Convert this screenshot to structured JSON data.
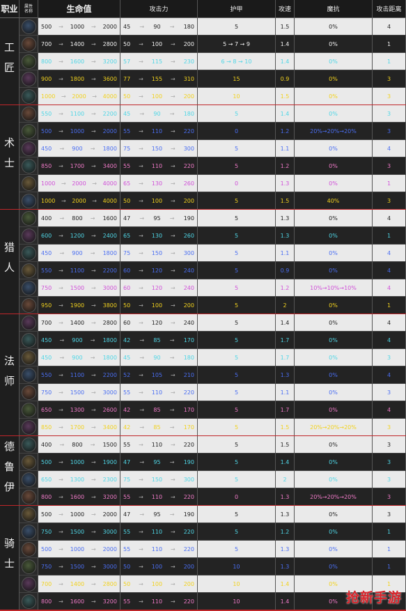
{
  "header": {
    "class": "职业",
    "avatar_top": "属性",
    "avatar_bottom": "名称",
    "hp": "生命值",
    "atk": "攻击力",
    "armor": "护甲",
    "speed": "攻速",
    "mr": "魔抗",
    "range": "攻击距离"
  },
  "colors": {
    "white": "#f2f2f2",
    "cyan": "#4fd6e6",
    "yellow": "#f2d21e",
    "pink": "#f07ac8",
    "blue": "#4a6ef2",
    "purple": "#d050d8",
    "orange": "#f0a020",
    "row_light": "#eaeaea",
    "row_dark": "#232323",
    "separator": "#c0262a"
  },
  "classes": [
    {
      "name": "工匠",
      "rows": [
        {
          "color": "white",
          "hp": [
            "500",
            "1000",
            "2000"
          ],
          "atk": [
            "45",
            "90",
            "180"
          ],
          "armor": "5",
          "speed": "1.5",
          "mr": "0%",
          "range": "4"
        },
        {
          "color": "white",
          "hp": [
            "700",
            "1400",
            "2800"
          ],
          "atk": [
            "50",
            "100",
            "200"
          ],
          "armor": "5 → 7 → 9",
          "speed": "1.4",
          "mr": "0%",
          "range": "1"
        },
        {
          "color": "cyan",
          "hp": [
            "800",
            "1600",
            "3200"
          ],
          "atk": [
            "57",
            "115",
            "230"
          ],
          "armor": "6 → 8 → 10",
          "speed": "1.4",
          "mr": "0%",
          "range": "1"
        },
        {
          "color": "yellow",
          "hp": [
            "900",
            "1800",
            "3600"
          ],
          "atk": [
            "77",
            "155",
            "310"
          ],
          "armor": "15",
          "speed": "0.9",
          "mr": "0%",
          "range": "3"
        },
        {
          "color": "yellow",
          "hp": [
            "1000",
            "2000",
            "4000"
          ],
          "atk": [
            "50",
            "100",
            "200"
          ],
          "armor": "10",
          "speed": "1.5",
          "mr": "0%",
          "range": "3"
        }
      ]
    },
    {
      "name": "术士",
      "rows": [
        {
          "color": "cyan",
          "hp": [
            "550",
            "1100",
            "2200"
          ],
          "atk": [
            "45",
            "90",
            "180"
          ],
          "armor": "5",
          "speed": "1.4",
          "mr": "0%",
          "range": "3"
        },
        {
          "color": "blue",
          "hp": [
            "500",
            "1000",
            "2000"
          ],
          "atk": [
            "55",
            "110",
            "220"
          ],
          "armor": "0",
          "speed": "1.2",
          "mr": "20%→20%→20%",
          "range": "3"
        },
        {
          "color": "blue",
          "hp": [
            "450",
            "900",
            "1800"
          ],
          "atk": [
            "75",
            "150",
            "300"
          ],
          "armor": "5",
          "speed": "1.1",
          "mr": "0%",
          "range": "4"
        },
        {
          "color": "pink",
          "hp": [
            "850",
            "1700",
            "3400"
          ],
          "atk": [
            "55",
            "110",
            "220"
          ],
          "armor": "5",
          "speed": "1.2",
          "mr": "0%",
          "range": "3"
        },
        {
          "color": "purple",
          "hp": [
            "1000",
            "2000",
            "4000"
          ],
          "atk": [
            "65",
            "130",
            "260"
          ],
          "armor": "0",
          "speed": "1.3",
          "mr": "0%",
          "range": "1"
        },
        {
          "color": "yellow",
          "hp": [
            "1000",
            "2000",
            "4000"
          ],
          "atk": [
            "50",
            "100",
            "200"
          ],
          "armor": "5",
          "speed": "1.5",
          "mr": "40%",
          "range": "3"
        }
      ]
    },
    {
      "name": "猎人",
      "rows": [
        {
          "color": "white",
          "hp": [
            "400",
            "800",
            "1600"
          ],
          "atk": [
            "47",
            "95",
            "190"
          ],
          "armor": "5",
          "speed": "1.3",
          "mr": "0%",
          "range": "4"
        },
        {
          "color": "cyan",
          "hp": [
            "600",
            "1200",
            "2400"
          ],
          "atk": [
            "65",
            "130",
            "260"
          ],
          "armor": "5",
          "speed": "1.3",
          "mr": "0%",
          "range": "1"
        },
        {
          "color": "blue",
          "hp": [
            "450",
            "900",
            "1800"
          ],
          "atk": [
            "75",
            "150",
            "300"
          ],
          "armor": "5",
          "speed": "1.1",
          "mr": "0%",
          "range": "4"
        },
        {
          "color": "blue",
          "hp": [
            "550",
            "1100",
            "2200"
          ],
          "atk": [
            "60",
            "120",
            "240"
          ],
          "armor": "5",
          "speed": "0.9",
          "mr": "0%",
          "range": "4"
        },
        {
          "color": "purple",
          "hp": [
            "750",
            "1500",
            "3000"
          ],
          "atk": [
            "60",
            "120",
            "240"
          ],
          "armor": "5",
          "speed": "1.2",
          "mr": "10%→10%→10%",
          "range": "4"
        },
        {
          "color": "yellow",
          "hp": [
            "950",
            "1900",
            "3800"
          ],
          "atk": [
            "50",
            "100",
            "200"
          ],
          "armor": "5",
          "speed": "2",
          "mr": "0%",
          "range": "1"
        }
      ]
    },
    {
      "name": "法师",
      "rows": [
        {
          "color": "white",
          "hp": [
            "700",
            "1400",
            "2800"
          ],
          "atk": [
            "60",
            "120",
            "240"
          ],
          "armor": "5",
          "speed": "1.4",
          "mr": "0%",
          "range": "4"
        },
        {
          "color": "cyan",
          "hp": [
            "450",
            "900",
            "1800"
          ],
          "atk": [
            "42",
            "85",
            "170"
          ],
          "armor": "5",
          "speed": "1.7",
          "mr": "0%",
          "range": "4"
        },
        {
          "color": "cyan",
          "hp": [
            "450",
            "900",
            "1800"
          ],
          "atk": [
            "45",
            "90",
            "180"
          ],
          "armor": "5",
          "speed": "1.7",
          "mr": "0%",
          "range": "3"
        },
        {
          "color": "blue",
          "hp": [
            "550",
            "1100",
            "2200"
          ],
          "atk": [
            "52",
            "105",
            "210"
          ],
          "armor": "5",
          "speed": "1.3",
          "mr": "0%",
          "range": "4"
        },
        {
          "color": "blue",
          "hp": [
            "750",
            "1500",
            "3000"
          ],
          "atk": [
            "55",
            "110",
            "220"
          ],
          "armor": "5",
          "speed": "1.1",
          "mr": "0%",
          "range": "3"
        },
        {
          "color": "pink",
          "hp": [
            "650",
            "1300",
            "2600"
          ],
          "atk": [
            "42",
            "85",
            "170"
          ],
          "armor": "5",
          "speed": "1.7",
          "mr": "0%",
          "range": "4"
        },
        {
          "color": "yellow",
          "hp": [
            "850",
            "1700",
            "3400"
          ],
          "atk": [
            "42",
            "85",
            "170"
          ],
          "armor": "5",
          "speed": "1.5",
          "mr": "20%→20%→20%",
          "range": "3"
        }
      ]
    },
    {
      "name": "德鲁伊",
      "rows": [
        {
          "color": "white",
          "hp": [
            "400",
            "800",
            "1500"
          ],
          "atk": [
            "55",
            "110",
            "220"
          ],
          "armor": "5",
          "speed": "1.5",
          "mr": "0%",
          "range": "3"
        },
        {
          "color": "cyan",
          "hp": [
            "500",
            "1000",
            "1900"
          ],
          "atk": [
            "47",
            "95",
            "190"
          ],
          "armor": "5",
          "speed": "1.4",
          "mr": "0%",
          "range": "3"
        },
        {
          "color": "cyan",
          "hp": [
            "650",
            "1300",
            "2300"
          ],
          "atk": [
            "75",
            "150",
            "300"
          ],
          "armor": "5",
          "speed": "2",
          "mr": "0%",
          "range": "3"
        },
        {
          "color": "pink",
          "hp": [
            "800",
            "1600",
            "3200"
          ],
          "atk": [
            "55",
            "110",
            "220"
          ],
          "armor": "0",
          "speed": "1.3",
          "mr": "20%→20%→20%",
          "range": "3"
        }
      ]
    },
    {
      "name": "骑士",
      "rows": [
        {
          "color": "white",
          "hp": [
            "500",
            "1000",
            "2000"
          ],
          "atk": [
            "47",
            "95",
            "190"
          ],
          "armor": "5",
          "speed": "1.3",
          "mr": "0%",
          "range": "3"
        },
        {
          "color": "cyan",
          "hp": [
            "750",
            "1500",
            "3000"
          ],
          "atk": [
            "55",
            "110",
            "220"
          ],
          "armor": "5",
          "speed": "1.2",
          "mr": "0%",
          "range": "1"
        },
        {
          "color": "blue",
          "hp": [
            "500",
            "1000",
            "2000"
          ],
          "atk": [
            "55",
            "110",
            "220"
          ],
          "armor": "5",
          "speed": "1.3",
          "mr": "0%",
          "range": "1"
        },
        {
          "color": "blue",
          "hp": [
            "750",
            "1500",
            "3000"
          ],
          "atk": [
            "50",
            "100",
            "200"
          ],
          "armor": "10",
          "speed": "1.3",
          "mr": "0%",
          "range": "1"
        },
        {
          "color": "yellow",
          "hp": [
            "700",
            "1400",
            "2800"
          ],
          "atk": [
            "50",
            "100",
            "200"
          ],
          "armor": "10",
          "speed": "1.4",
          "mr": "0%",
          "range": "1"
        },
        {
          "color": "pink",
          "hp": [
            "800",
            "1600",
            "3200"
          ],
          "atk": [
            "55",
            "110",
            "220"
          ],
          "armor": "10",
          "speed": "1.4",
          "mr": "0%",
          "range": "1"
        }
      ]
    }
  ],
  "watermark": "抢新手游"
}
